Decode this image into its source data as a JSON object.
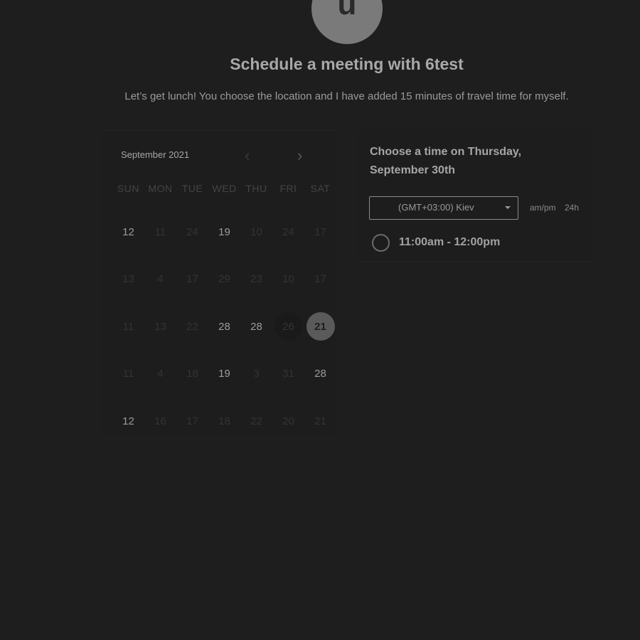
{
  "avatar": {
    "initial": "u"
  },
  "header": {
    "title": "Schedule a meeting with 6test",
    "description": "Let’s get lunch! You choose the location and I have added 15 minutes of travel time for myself."
  },
  "calendar": {
    "month_label": "September 2021",
    "prev_icon": "chevron-left-icon",
    "next_icon": "chevron-right-icon",
    "weekdays": [
      "SUN",
      "MON",
      "TUE",
      "WED",
      "THU",
      "FRI",
      "SAT"
    ],
    "days": [
      {
        "label": "12",
        "state": "available"
      },
      {
        "label": "11",
        "state": "disabled"
      },
      {
        "label": "24",
        "state": "disabled"
      },
      {
        "label": "19",
        "state": "available"
      },
      {
        "label": "10",
        "state": "disabled"
      },
      {
        "label": "24",
        "state": "disabled"
      },
      {
        "label": "17",
        "state": "disabled"
      },
      {
        "label": "13",
        "state": "disabled"
      },
      {
        "label": "4",
        "state": "disabled"
      },
      {
        "label": "17",
        "state": "disabled"
      },
      {
        "label": "29",
        "state": "disabled"
      },
      {
        "label": "23",
        "state": "disabled"
      },
      {
        "label": "10",
        "state": "disabled"
      },
      {
        "label": "17",
        "state": "disabled"
      },
      {
        "label": "11",
        "state": "disabled"
      },
      {
        "label": "13",
        "state": "disabled"
      },
      {
        "label": "22",
        "state": "disabled"
      },
      {
        "label": "28",
        "state": "available"
      },
      {
        "label": "28",
        "state": "available"
      },
      {
        "label": "26",
        "state": "today"
      },
      {
        "label": "21",
        "state": "selected"
      },
      {
        "label": "11",
        "state": "disabled"
      },
      {
        "label": "4",
        "state": "disabled"
      },
      {
        "label": "18",
        "state": "disabled"
      },
      {
        "label": "19",
        "state": "available"
      },
      {
        "label": "3",
        "state": "disabled"
      },
      {
        "label": "31",
        "state": "disabled"
      },
      {
        "label": "28",
        "state": "available"
      },
      {
        "label": "12",
        "state": "available"
      },
      {
        "label": "16",
        "state": "disabled"
      },
      {
        "label": "17",
        "state": "disabled"
      },
      {
        "label": "18",
        "state": "disabled"
      },
      {
        "label": "22",
        "state": "disabled"
      },
      {
        "label": "20",
        "state": "disabled"
      },
      {
        "label": "21",
        "state": "disabled"
      }
    ]
  },
  "times": {
    "heading": "Choose a time on Thursday, September 30th",
    "timezone": "(GMT+03:00) Kiev",
    "dropdown_icon": "caret-down-icon",
    "format_ampm": "am/pm",
    "format_24h": "24h",
    "slots": [
      {
        "label": "11:00am - 12:00pm"
      }
    ]
  }
}
